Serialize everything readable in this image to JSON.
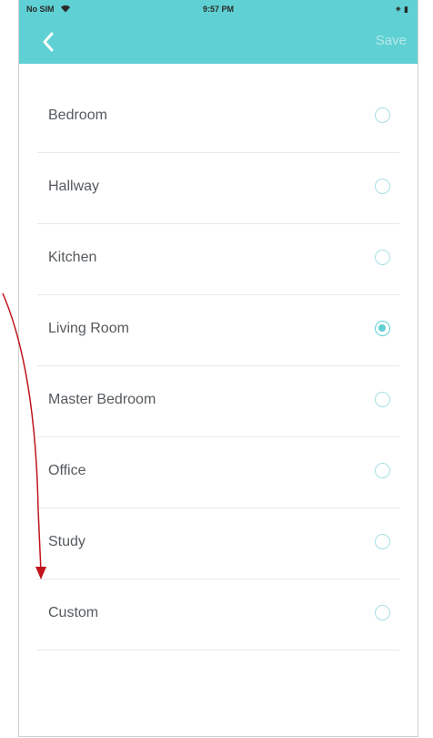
{
  "status_bar": {
    "carrier": "No SIM",
    "time": "9:57 PM",
    "battery": "✷ ▮"
  },
  "nav": {
    "back_icon": "chevron-left-icon",
    "save_label": "Save"
  },
  "rooms": [
    {
      "label": "Bedroom",
      "selected": false
    },
    {
      "label": "Hallway",
      "selected": false
    },
    {
      "label": "Kitchen",
      "selected": false
    },
    {
      "label": "Living Room",
      "selected": true
    },
    {
      "label": "Master Bedroom",
      "selected": false
    },
    {
      "label": "Office",
      "selected": false
    },
    {
      "label": "Study",
      "selected": false
    },
    {
      "label": "Custom",
      "selected": false
    }
  ],
  "colors": {
    "accent": "#5fd0d3",
    "annotation": "#c0141c"
  }
}
